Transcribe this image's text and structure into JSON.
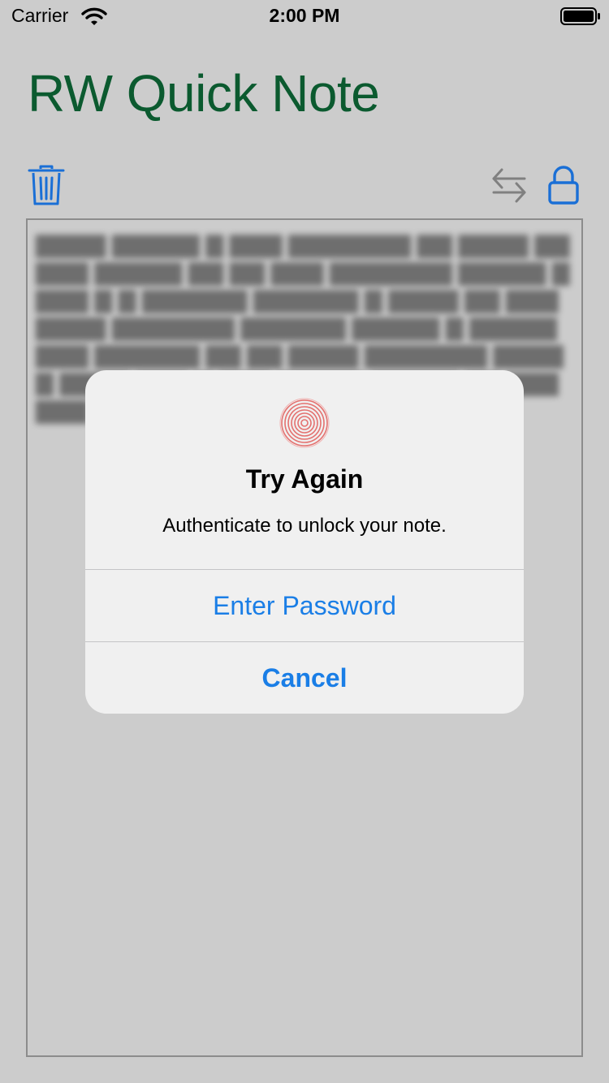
{
  "status_bar": {
    "carrier": "Carrier",
    "time": "2:00 PM",
    "wifi_icon": "wifi-icon",
    "battery_icon": "battery-icon"
  },
  "app": {
    "title": "RW Quick Note",
    "title_color": "#0b5a2f"
  },
  "toolbar": {
    "delete_icon": "trash-icon",
    "swap_icon": "swap-arrows-icon",
    "lock_icon": "lock-icon",
    "accent_color": "#1a6fd6"
  },
  "alert": {
    "icon": "fingerprint-icon",
    "title": "Try Again",
    "message": "Authenticate to unlock your note.",
    "primary_button": "Enter Password",
    "cancel_button": "Cancel",
    "button_color": "#1a7ee6"
  }
}
